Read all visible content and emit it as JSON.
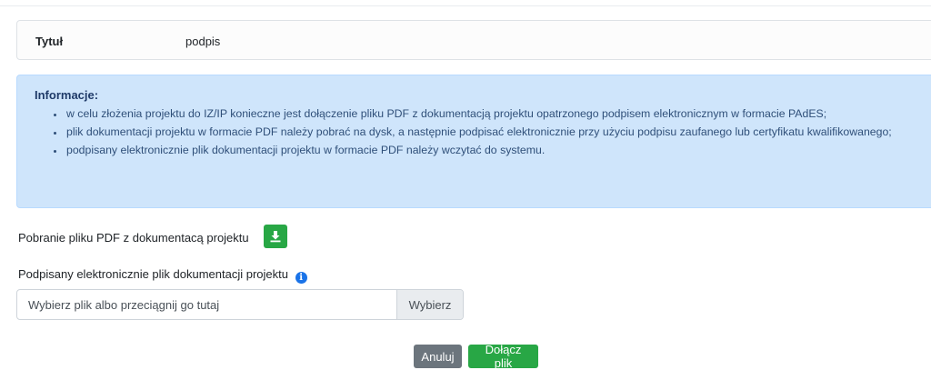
{
  "title_row": {
    "label": "Tytuł",
    "value": "podpis"
  },
  "info": {
    "heading": "Informacje:",
    "items": [
      "w celu złożenia projektu do IZ/IP konieczne jest dołączenie pliku PDF z dokumentacją projektu opatrzonego podpisem elektronicznym w formacie PAdES;",
      "plik dokumentacji projektu w formacie PDF należy pobrać na dysk, a następnie podpisać elektronicznie przy użyciu podpisu zaufanego lub certyfikatu kwalifikowanego;",
      "podpisany elektronicznie plik dokumentacji projektu w formacie PDF należy wczytać do systemu."
    ]
  },
  "download": {
    "label": "Pobranie pliku PDF z dokumentacą projektu",
    "icon": "download-icon"
  },
  "signed_file": {
    "label": "Podpisany elektronicznie plik dokumentacji projektu",
    "info_icon": "info-icon",
    "placeholder": "Wybierz plik albo przeciągnij go tutaj",
    "browse_label": "Wybierz"
  },
  "actions": {
    "cancel_label": "Anuluj",
    "attach_label": "Dołącz plik"
  },
  "colors": {
    "info_bg": "#cfe5fb",
    "success": "#28a745",
    "secondary": "#6c757d",
    "info_icon": "#1a73e8"
  }
}
